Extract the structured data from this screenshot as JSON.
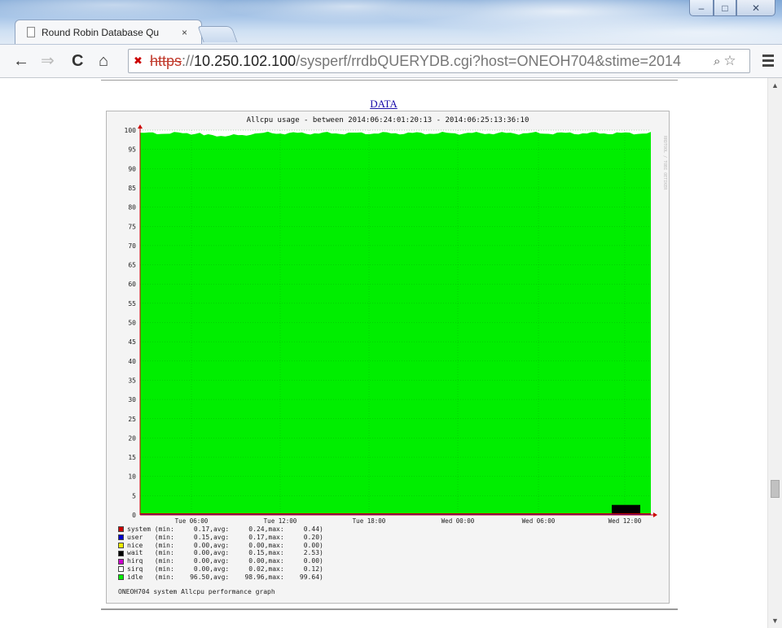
{
  "window": {
    "tab_title": "Round Robin Database Qu",
    "tab_close": "×",
    "controls": {
      "minimize": "–",
      "maximize": "□",
      "close": "✕"
    }
  },
  "toolbar": {
    "url_scheme": "https",
    "url_host": "10.250.102.100",
    "url_path": "/sysperf/rrdbQUERYDB.cgi?host=ONEOH704&stime=2014",
    "back_icon": "back-arrow-icon",
    "forward_icon": "forward-arrow-icon",
    "reload_icon": "reload-icon",
    "home_icon": "home-icon"
  },
  "page": {
    "data_link": "DATA",
    "caption": "ONEOH704 system Allcpu performance graph"
  },
  "chart_data": {
    "type": "area",
    "title": "Allcpu usage - between 2014:06:24:01:20:13 - 2014:06:25:13:36:10",
    "side_label": "RRDTOOL / TOBI OETIKER",
    "ylim": [
      0,
      100
    ],
    "yticks": [
      0,
      5,
      10,
      15,
      20,
      25,
      30,
      35,
      40,
      45,
      50,
      55,
      60,
      65,
      70,
      75,
      80,
      85,
      90,
      95,
      100
    ],
    "xticks": [
      "Tue 06:00",
      "Tue 12:00",
      "Tue 18:00",
      "Wed 00:00",
      "Wed 06:00",
      "Wed 12:00"
    ],
    "grid": true,
    "colors": {
      "system": "#cc0000",
      "user": "#0000cc",
      "nice": "#eeee00",
      "wait": "#000000",
      "hirq": "#cc00cc",
      "sirq": "#ffffff",
      "idle": "#00ee00"
    },
    "series": [
      {
        "name": "system",
        "min": "0.17",
        "avg": "0.24",
        "max": "0.44"
      },
      {
        "name": "user",
        "min": "0.15",
        "avg": "0.17",
        "max": "0.20"
      },
      {
        "name": "nice",
        "min": "0.00",
        "avg": "0.00",
        "max": "0.00"
      },
      {
        "name": "wait",
        "min": "0.00",
        "avg": "0.15",
        "max": "2.53"
      },
      {
        "name": "hirq",
        "min": "0.00",
        "avg": "0.00",
        "max": "0.00"
      },
      {
        "name": "sirq",
        "min": "0.00",
        "avg": "0.02",
        "max": "0.12"
      },
      {
        "name": "idle",
        "min": "96.50",
        "avg": "98.96",
        "max": "99.64"
      }
    ],
    "legend_rows": [
      "system (min:     0.17,avg:     0.24,max:     0.44)",
      "user   (min:     0.15,avg:     0.17,max:     0.20)",
      "nice   (min:     0.00,avg:     0.00,max:     0.00)",
      "wait   (min:     0.00,avg:     0.15,max:     2.53)",
      "hirq   (min:     0.00,avg:     0.00,max:     0.00)",
      "sirq   (min:     0.00,avg:     0.02,max:     0.12)",
      "idle   (min:    96.50,avg:    98.96,max:    99.64)"
    ]
  }
}
